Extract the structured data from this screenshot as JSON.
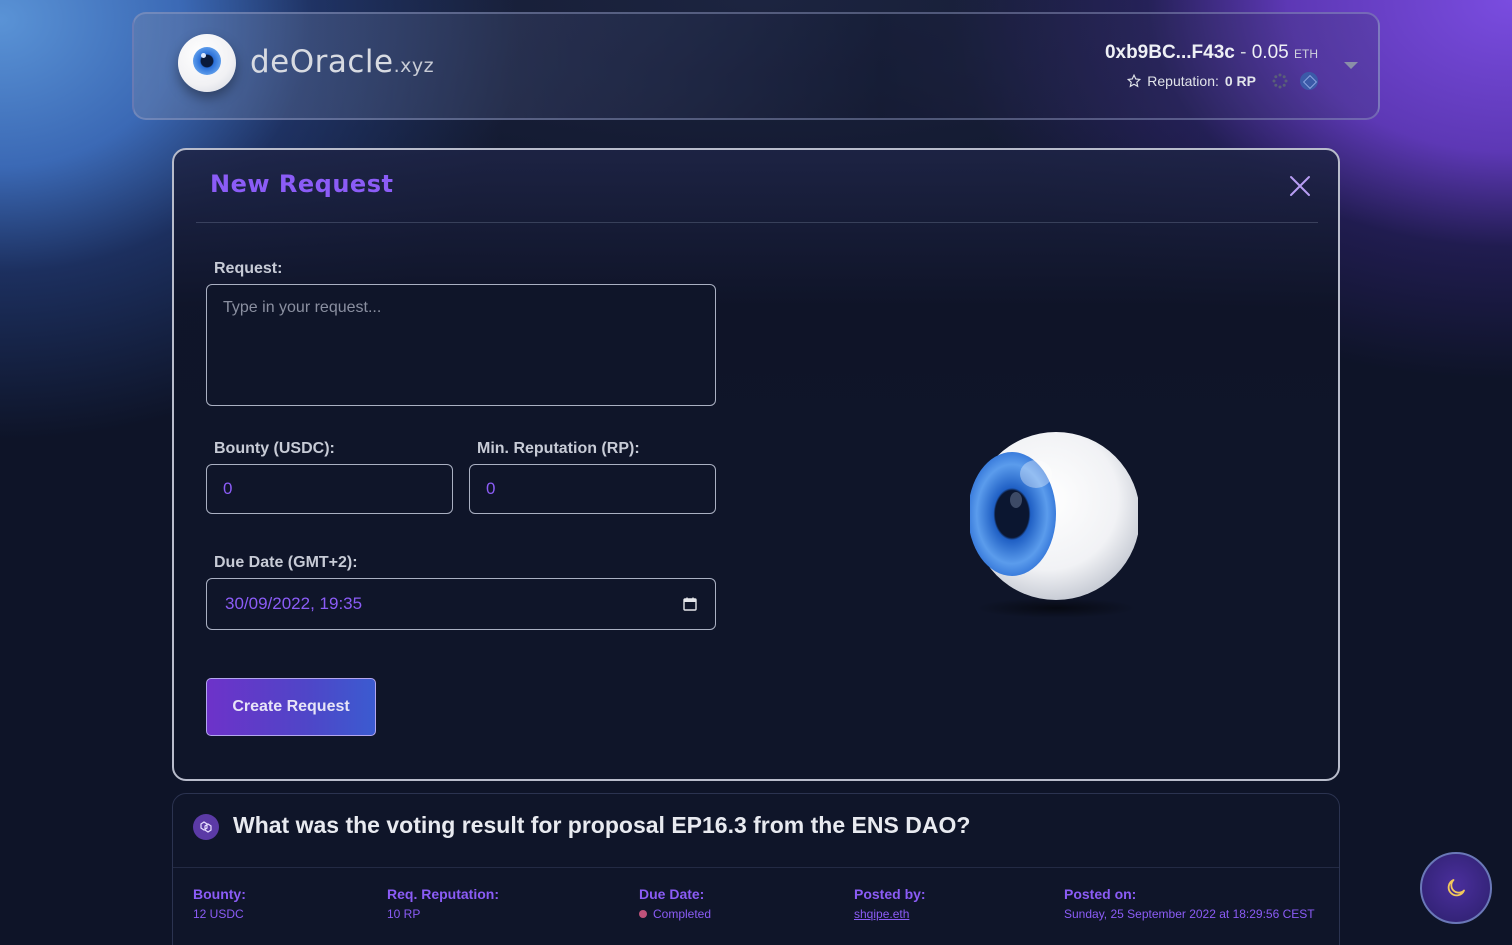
{
  "header": {
    "brand_main": "deOracle",
    "brand_tld": ".xyz",
    "wallet_address": "0xb9BC...F43c",
    "wallet_separator": " - ",
    "wallet_balance": "0.05",
    "wallet_unit": "ETH",
    "reputation_label": "Reputation:",
    "reputation_value": "0 RP"
  },
  "form": {
    "title": "New Request",
    "request_label": "Request:",
    "request_placeholder": "Type in your request...",
    "bounty_label": "Bounty (USDC):",
    "bounty_value": "0",
    "min_rep_label": "Min. Reputation (RP):",
    "min_rep_value": "0",
    "due_date_label": "Due Date (GMT+2):",
    "due_date_value": "30/09/2022, 19:35",
    "create_button": "Create Request"
  },
  "request_card": {
    "question": "What was the voting result for proposal EP16.3 from the ENS DAO?",
    "bounty_label": "Bounty:",
    "bounty_value": "12 USDC",
    "req_rep_label": "Req. Reputation:",
    "req_rep_value": "10 RP",
    "due_date_label": "Due Date:",
    "due_date_value": "Completed",
    "posted_by_label": "Posted by:",
    "posted_by_value": "shqipe.eth",
    "posted_on_label": "Posted on:",
    "posted_on_value": "Sunday, 25 September 2022 at 18:29:56 CEST"
  },
  "colors": {
    "accent": "#8b5cf6",
    "status_completed": "#c0527a"
  }
}
